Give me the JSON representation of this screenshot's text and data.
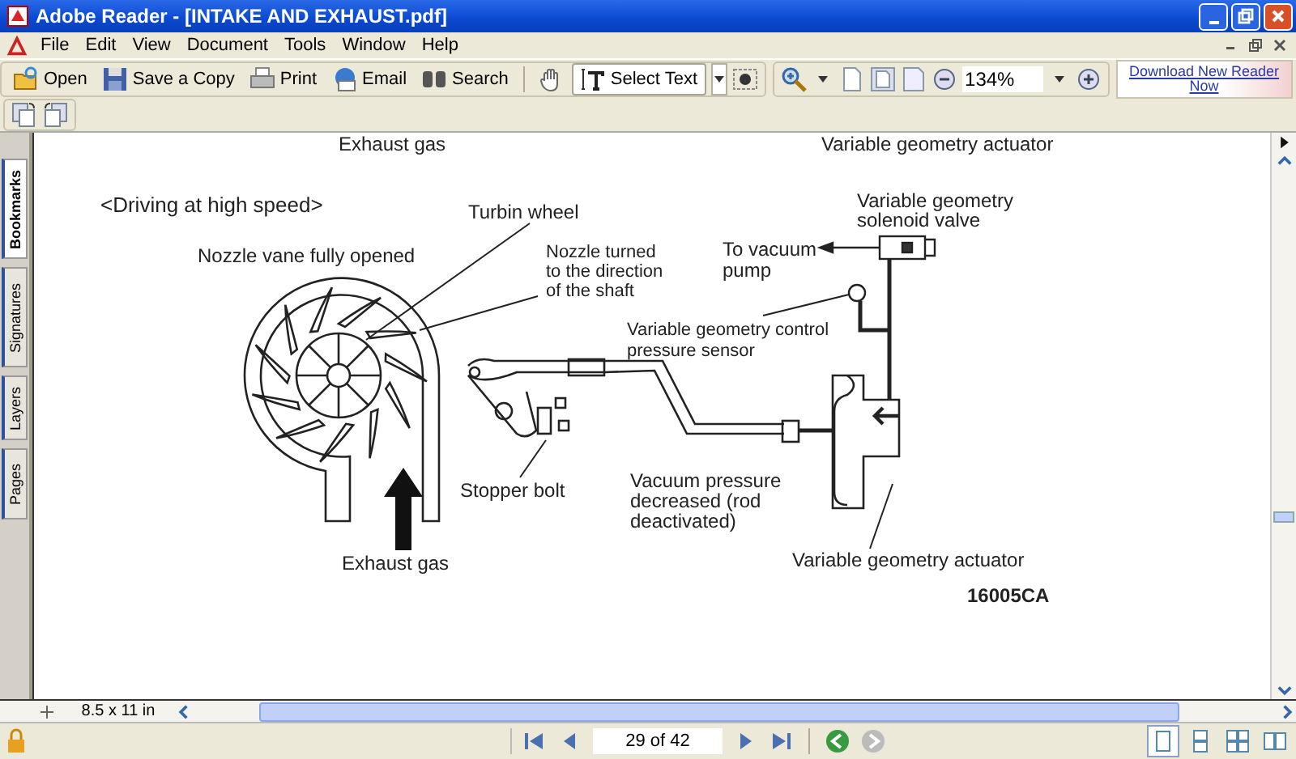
{
  "window": {
    "title": "Adobe Reader - [INTAKE AND EXHAUST.pdf]"
  },
  "menu": [
    "File",
    "Edit",
    "View",
    "Document",
    "Tools",
    "Window",
    "Help"
  ],
  "toolbar": {
    "buttons": [
      {
        "kind": "open",
        "label": "Open"
      },
      {
        "kind": "save",
        "label": "Save a Copy"
      },
      {
        "kind": "print",
        "label": "Print"
      },
      {
        "kind": "email",
        "label": "Email"
      },
      {
        "kind": "search",
        "label": "Search"
      }
    ],
    "hand_tool": {
      "selected": false
    },
    "select_text_tool": {
      "label": "Select Text",
      "selected": true
    },
    "zoom_value": "134%",
    "ad_link": "Download New Reader Now"
  },
  "side_tabs": [
    {
      "label": "Bookmarks",
      "selected": true
    },
    {
      "label": "Signatures",
      "selected": false
    },
    {
      "label": "Layers",
      "selected": false
    },
    {
      "label": "Pages",
      "selected": false
    }
  ],
  "diagram": {
    "cut_top_left": "Exhaust gas",
    "cut_top_right": "Variable geometry actuator",
    "heading": "<Driving at high speed>",
    "turbine_wheel": "Turbin wheel",
    "nozzle_vane": "Nozzle vane fully opened",
    "nozzle_turned": [
      "Nozzle turned",
      "to the direction",
      "of the shaft"
    ],
    "solenoid_valve": [
      "Variable geometry",
      "solenoid valve"
    ],
    "vacuum_pump": [
      "To vacuum",
      "pump"
    ],
    "pressure_sensor": [
      "Variable geometry control",
      "pressure sensor"
    ],
    "stopper_bolt": "Stopper bolt",
    "vacuum_pressure": [
      "Vacuum pressure",
      "decreased (rod",
      "deactivated)"
    ],
    "exhaust_gas": "Exhaust gas",
    "actuator": "Variable geometry actuator",
    "figure_code": "16005CA"
  },
  "page_size": "8.5 x 11 in",
  "page_field": "29 of 42",
  "view_modes": [
    {
      "selected": true
    },
    {
      "selected": false
    },
    {
      "selected": false
    },
    {
      "selected": false
    }
  ]
}
